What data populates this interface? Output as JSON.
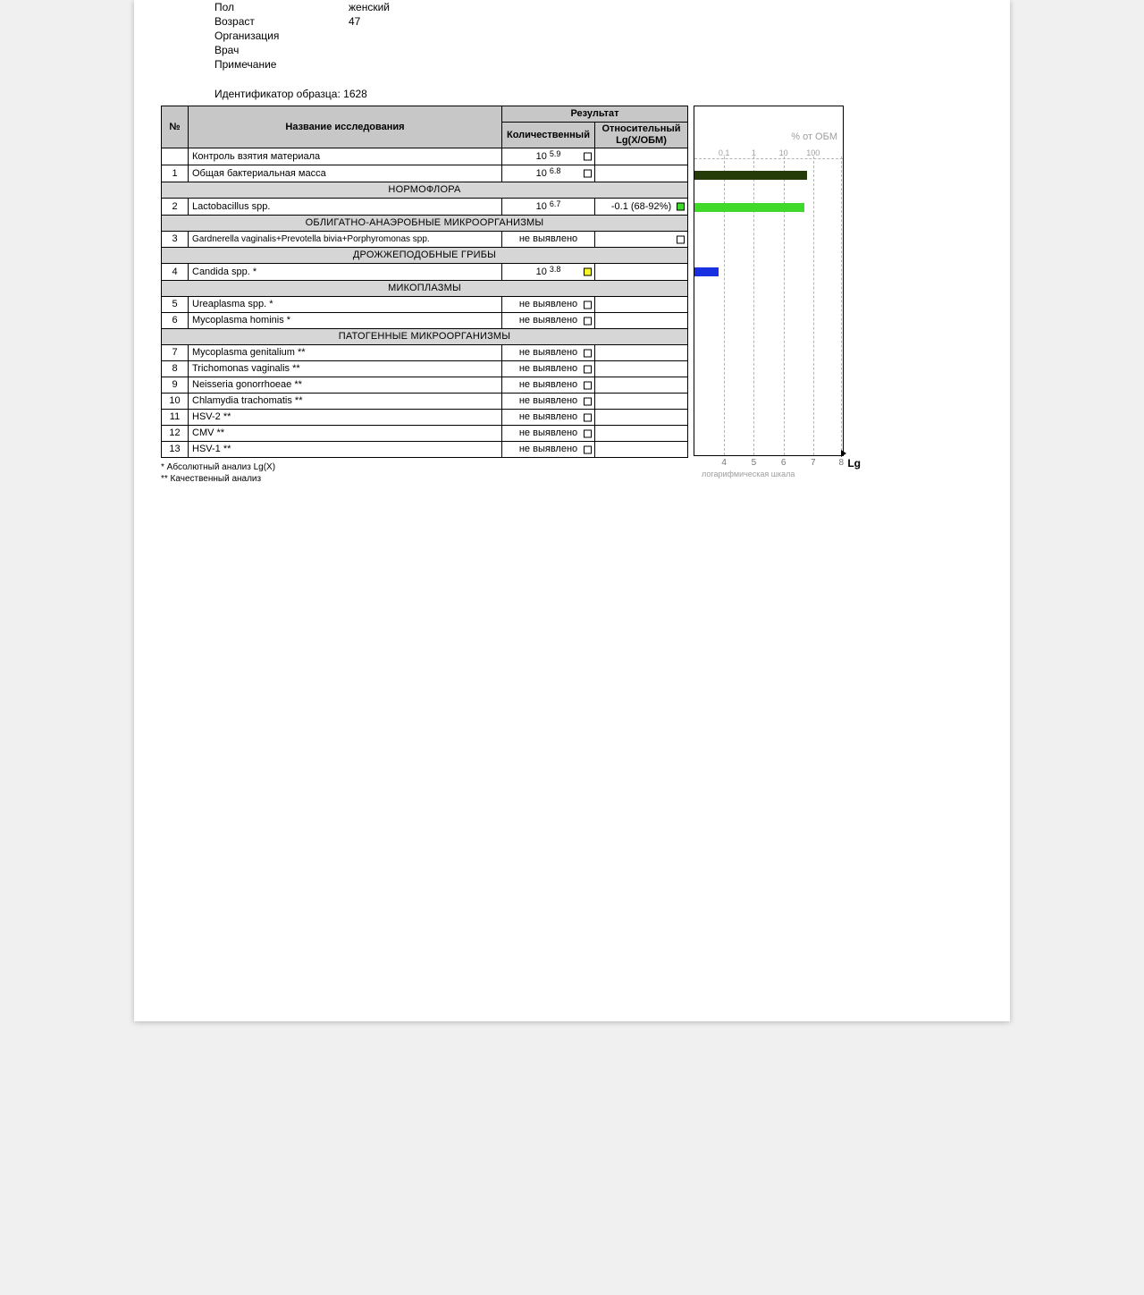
{
  "meta": {
    "sex_label": "Пол",
    "sex_value": "женский",
    "age_label": "Возраст",
    "age_value": "47",
    "org_label": "Организация",
    "org_value": "",
    "doctor_label": "Врач",
    "doctor_value": "",
    "note_label": "Примечание",
    "note_value": "",
    "sample_id_label": "Идентификатор образца:",
    "sample_id_value": "1628"
  },
  "headers": {
    "num": "№",
    "name": "Название исследования",
    "result": "Результат",
    "quant": "Количественный",
    "rel": "Относительный Lg(X/ОБМ)"
  },
  "sections": {
    "normoflora": "НОРМОФЛОРА",
    "obligate": "ОБЛИГАТНО-АНАЭРОБНЫЕ МИКРООРГАНИЗМЫ",
    "yeast": "ДРОЖЖЕПОДОБНЫЕ ГРИБЫ",
    "myco": "МИКОПЛАЗМЫ",
    "patho": "ПАТОГЕННЫЕ МИКРООРГАНИЗМЫ"
  },
  "rows": {
    "control": {
      "num": "",
      "name": "Контроль взятия материала",
      "base": "10",
      "exp": "5.9",
      "mk": "plain",
      "rel": ""
    },
    "total": {
      "num": "1",
      "name": "Общая бактериальная масса",
      "base": "10",
      "exp": "6.8",
      "mk": "plain",
      "rel": ""
    },
    "lacto": {
      "num": "2",
      "name": "Lactobacillus spp.",
      "base": "10",
      "exp": "6.7",
      "mk": "green",
      "rel": "-0.1 (68-92%)"
    },
    "gardner": {
      "num": "3",
      "name": "Gardnerella vaginalis+Prevotella bivia+Porphyromonas spp.",
      "val": "не выявлено",
      "mk": "plain",
      "rel": ""
    },
    "candida": {
      "num": "4",
      "name": "Candida spp. *",
      "base": "10",
      "exp": "3.8",
      "mk": "yellow",
      "rel": ""
    },
    "urea": {
      "num": "5",
      "name": "Ureaplasma spp. *",
      "val": "не выявлено",
      "mk": "plain",
      "rel": ""
    },
    "mhominis": {
      "num": "6",
      "name": "Mycoplasma hominis *",
      "val": "не выявлено",
      "mk": "plain",
      "rel": ""
    },
    "mgen": {
      "num": "7",
      "name": "Mycoplasma genitalium **",
      "val": "не выявлено",
      "mk": "plain",
      "rel": ""
    },
    "trich": {
      "num": "8",
      "name": "Trichomonas vaginalis **",
      "val": "не выявлено",
      "mk": "plain",
      "rel": ""
    },
    "neiss": {
      "num": "9",
      "name": "Neisseria gonorrhoeae **",
      "val": "не выявлено",
      "mk": "plain",
      "rel": ""
    },
    "chlam": {
      "num": "10",
      "name": "Chlamydia trachomatis **",
      "val": "не выявлено",
      "mk": "plain",
      "rel": ""
    },
    "hsv2": {
      "num": "11",
      "name": "HSV-2 **",
      "val": "не выявлено",
      "mk": "plain",
      "rel": ""
    },
    "cmv": {
      "num": "12",
      "name": "CMV **",
      "val": "не выявлено",
      "mk": "plain",
      "rel": ""
    },
    "hsv1": {
      "num": "13",
      "name": "HSV-1 **",
      "val": "не выявлено",
      "mk": "plain",
      "rel": ""
    }
  },
  "footnotes": {
    "f1": "*  Абсолютный анализ Lg(X)",
    "f2": "** Качественный анализ"
  },
  "chart": {
    "title": "% от ОБМ",
    "top_ticks": {
      "t01": "0.1",
      "t1": "1",
      "t10": "10",
      "t100": "100"
    },
    "bot_ticks": {
      "b4": "4",
      "b5": "5",
      "b6": "6",
      "b7": "7",
      "b8": "8"
    },
    "axis_label": "Lg",
    "caption": "логарифмическая шкала"
  },
  "chart_data": {
    "type": "bar",
    "orientation": "horizontal",
    "xlabel": "Lg",
    "caption": "логарифмическая шкала",
    "top_scale_label": "% от ОБМ",
    "lg_range": [
      3,
      8
    ],
    "percent_ticks": [
      0.1,
      1,
      10,
      100
    ],
    "lg_ticks": [
      4,
      5,
      6,
      7,
      8
    ],
    "series": [
      {
        "name": "Общая бактериальная масса",
        "lg_value": 6.8,
        "color": "#253b08"
      },
      {
        "name": "Lactobacillus spp.",
        "lg_value": 6.7,
        "percent_of_obm_range": [
          68,
          92
        ],
        "rel_lg": -0.1,
        "color": "#3fd929"
      },
      {
        "name": "Candida spp.",
        "lg_value": 3.8,
        "color": "#1731e2"
      }
    ]
  }
}
